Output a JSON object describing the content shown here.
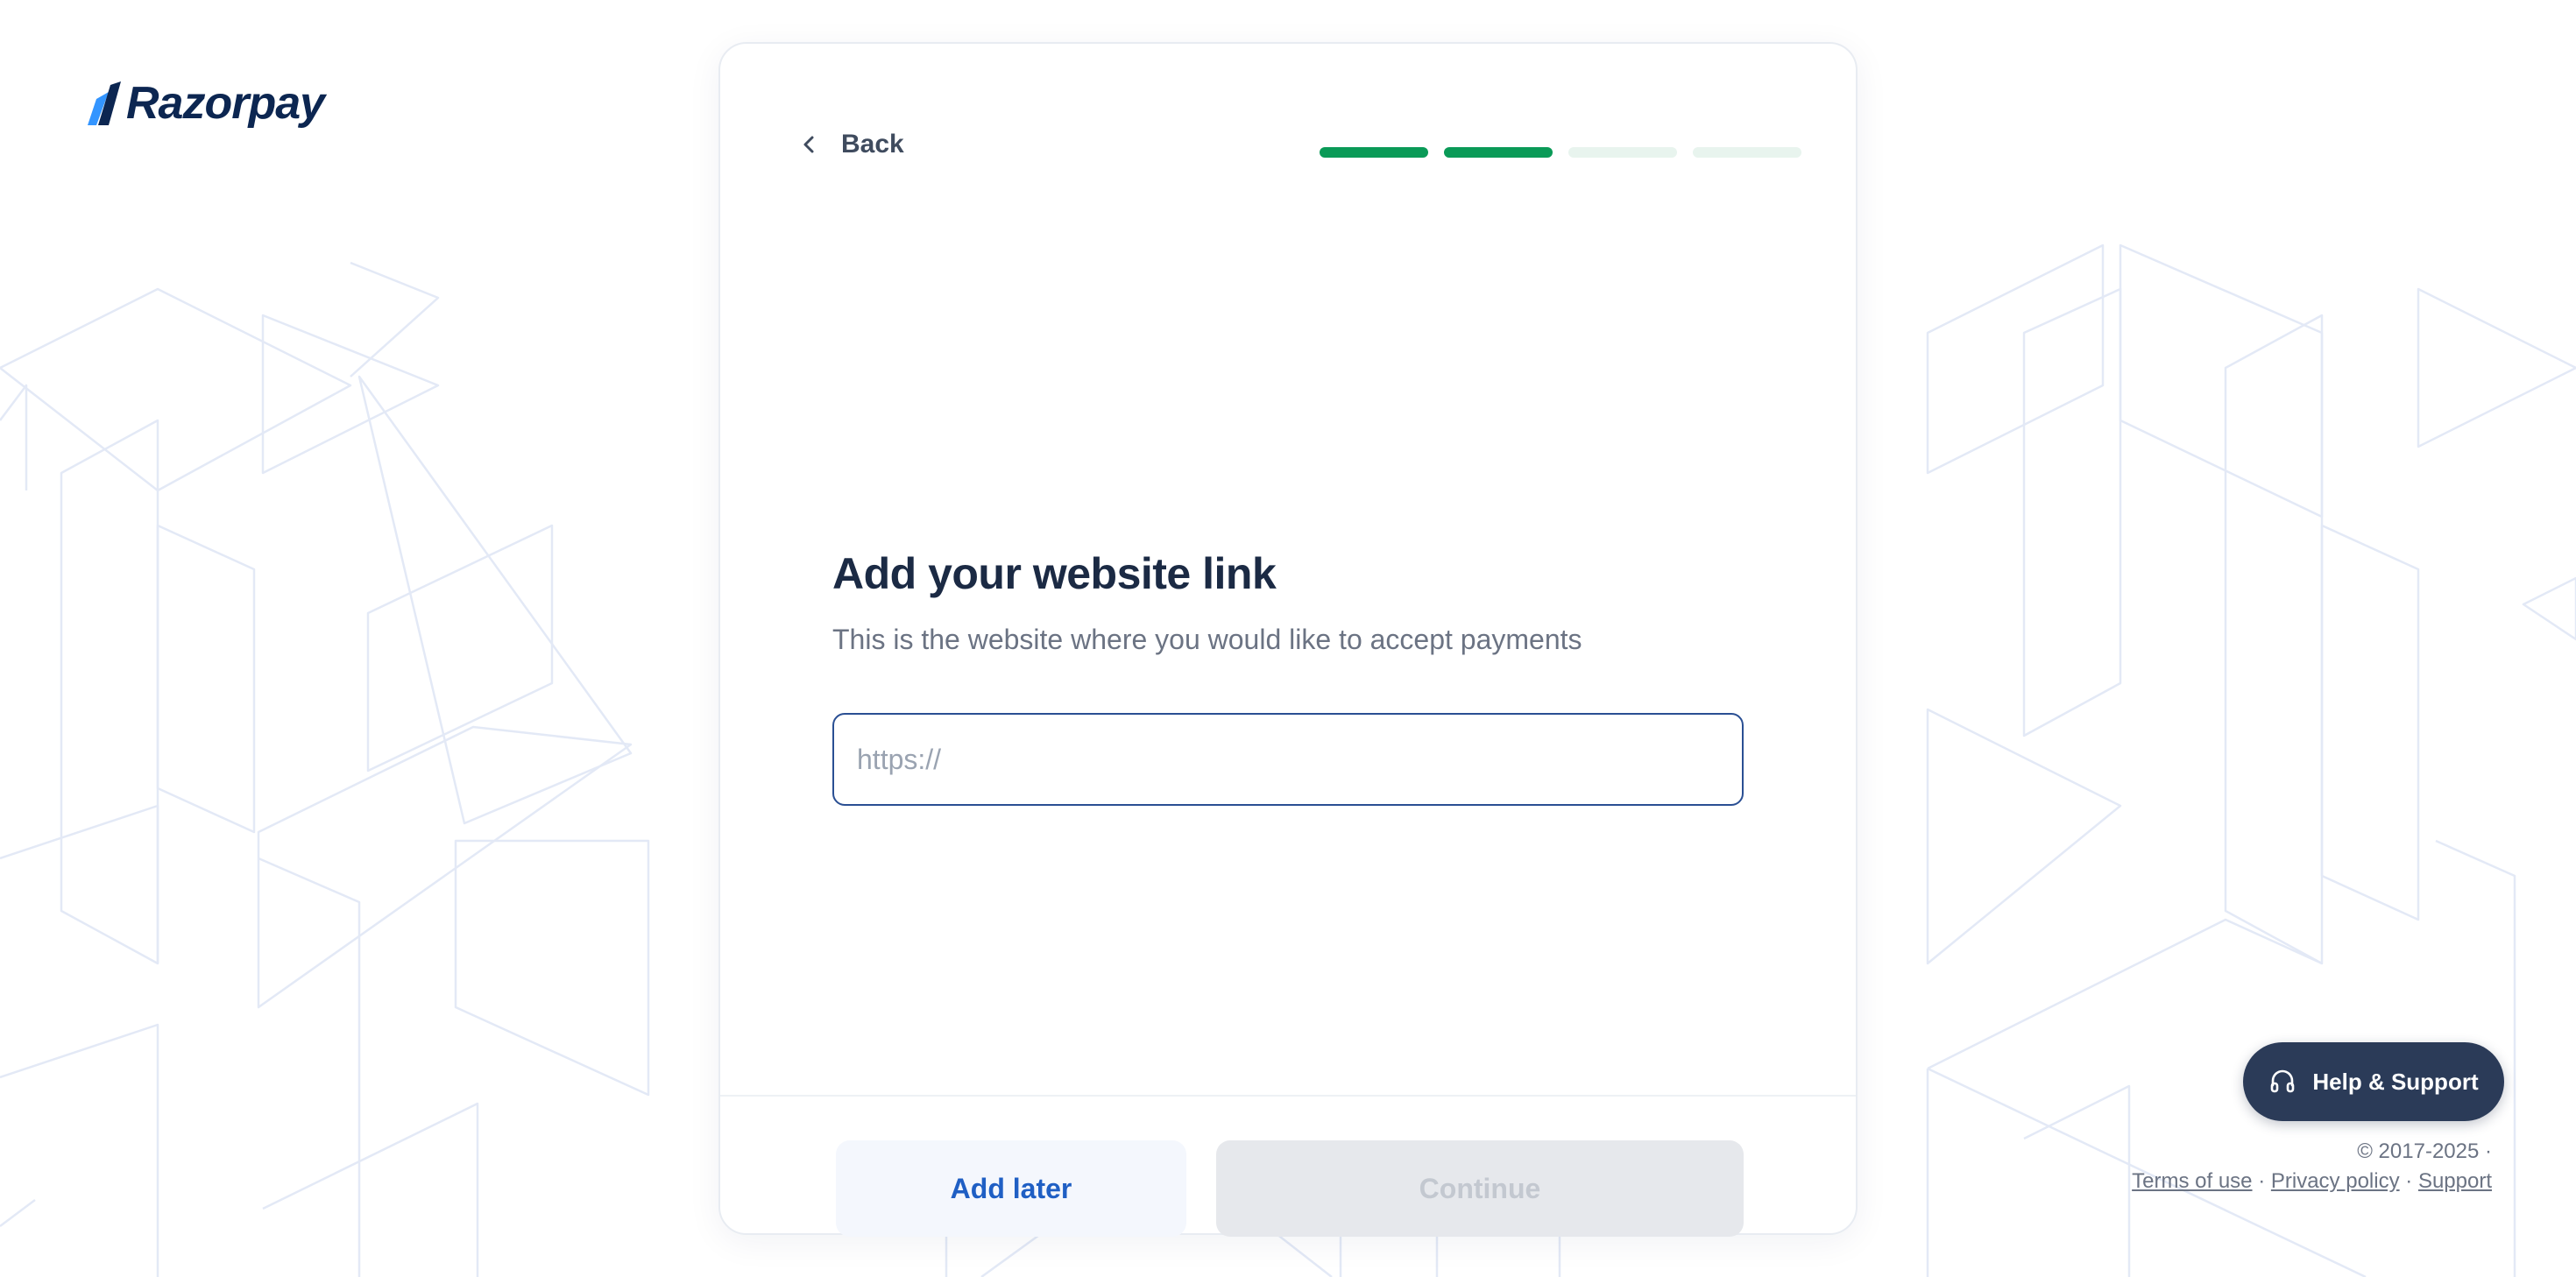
{
  "brand": {
    "name": "Razorpay",
    "color": "#0c2651",
    "accent": "#3395ff"
  },
  "header": {
    "back_label": "Back",
    "progress": {
      "total_steps": 4,
      "completed_steps": 2,
      "color": "#0a9a57"
    }
  },
  "form": {
    "title": "Add your website link",
    "subtitle": "This is the website where you would like to accept payments",
    "website_input": {
      "value": "",
      "placeholder": "https://"
    }
  },
  "actions": {
    "add_later_label": "Add later",
    "continue_label": "Continue",
    "continue_disabled": true
  },
  "support": {
    "label": "Help & Support",
    "icon": "headphones-icon"
  },
  "footer": {
    "copyright": "© 2017-2025 ·",
    "links": [
      "Terms of use",
      "Privacy policy",
      "Support"
    ],
    "separator": "·"
  }
}
